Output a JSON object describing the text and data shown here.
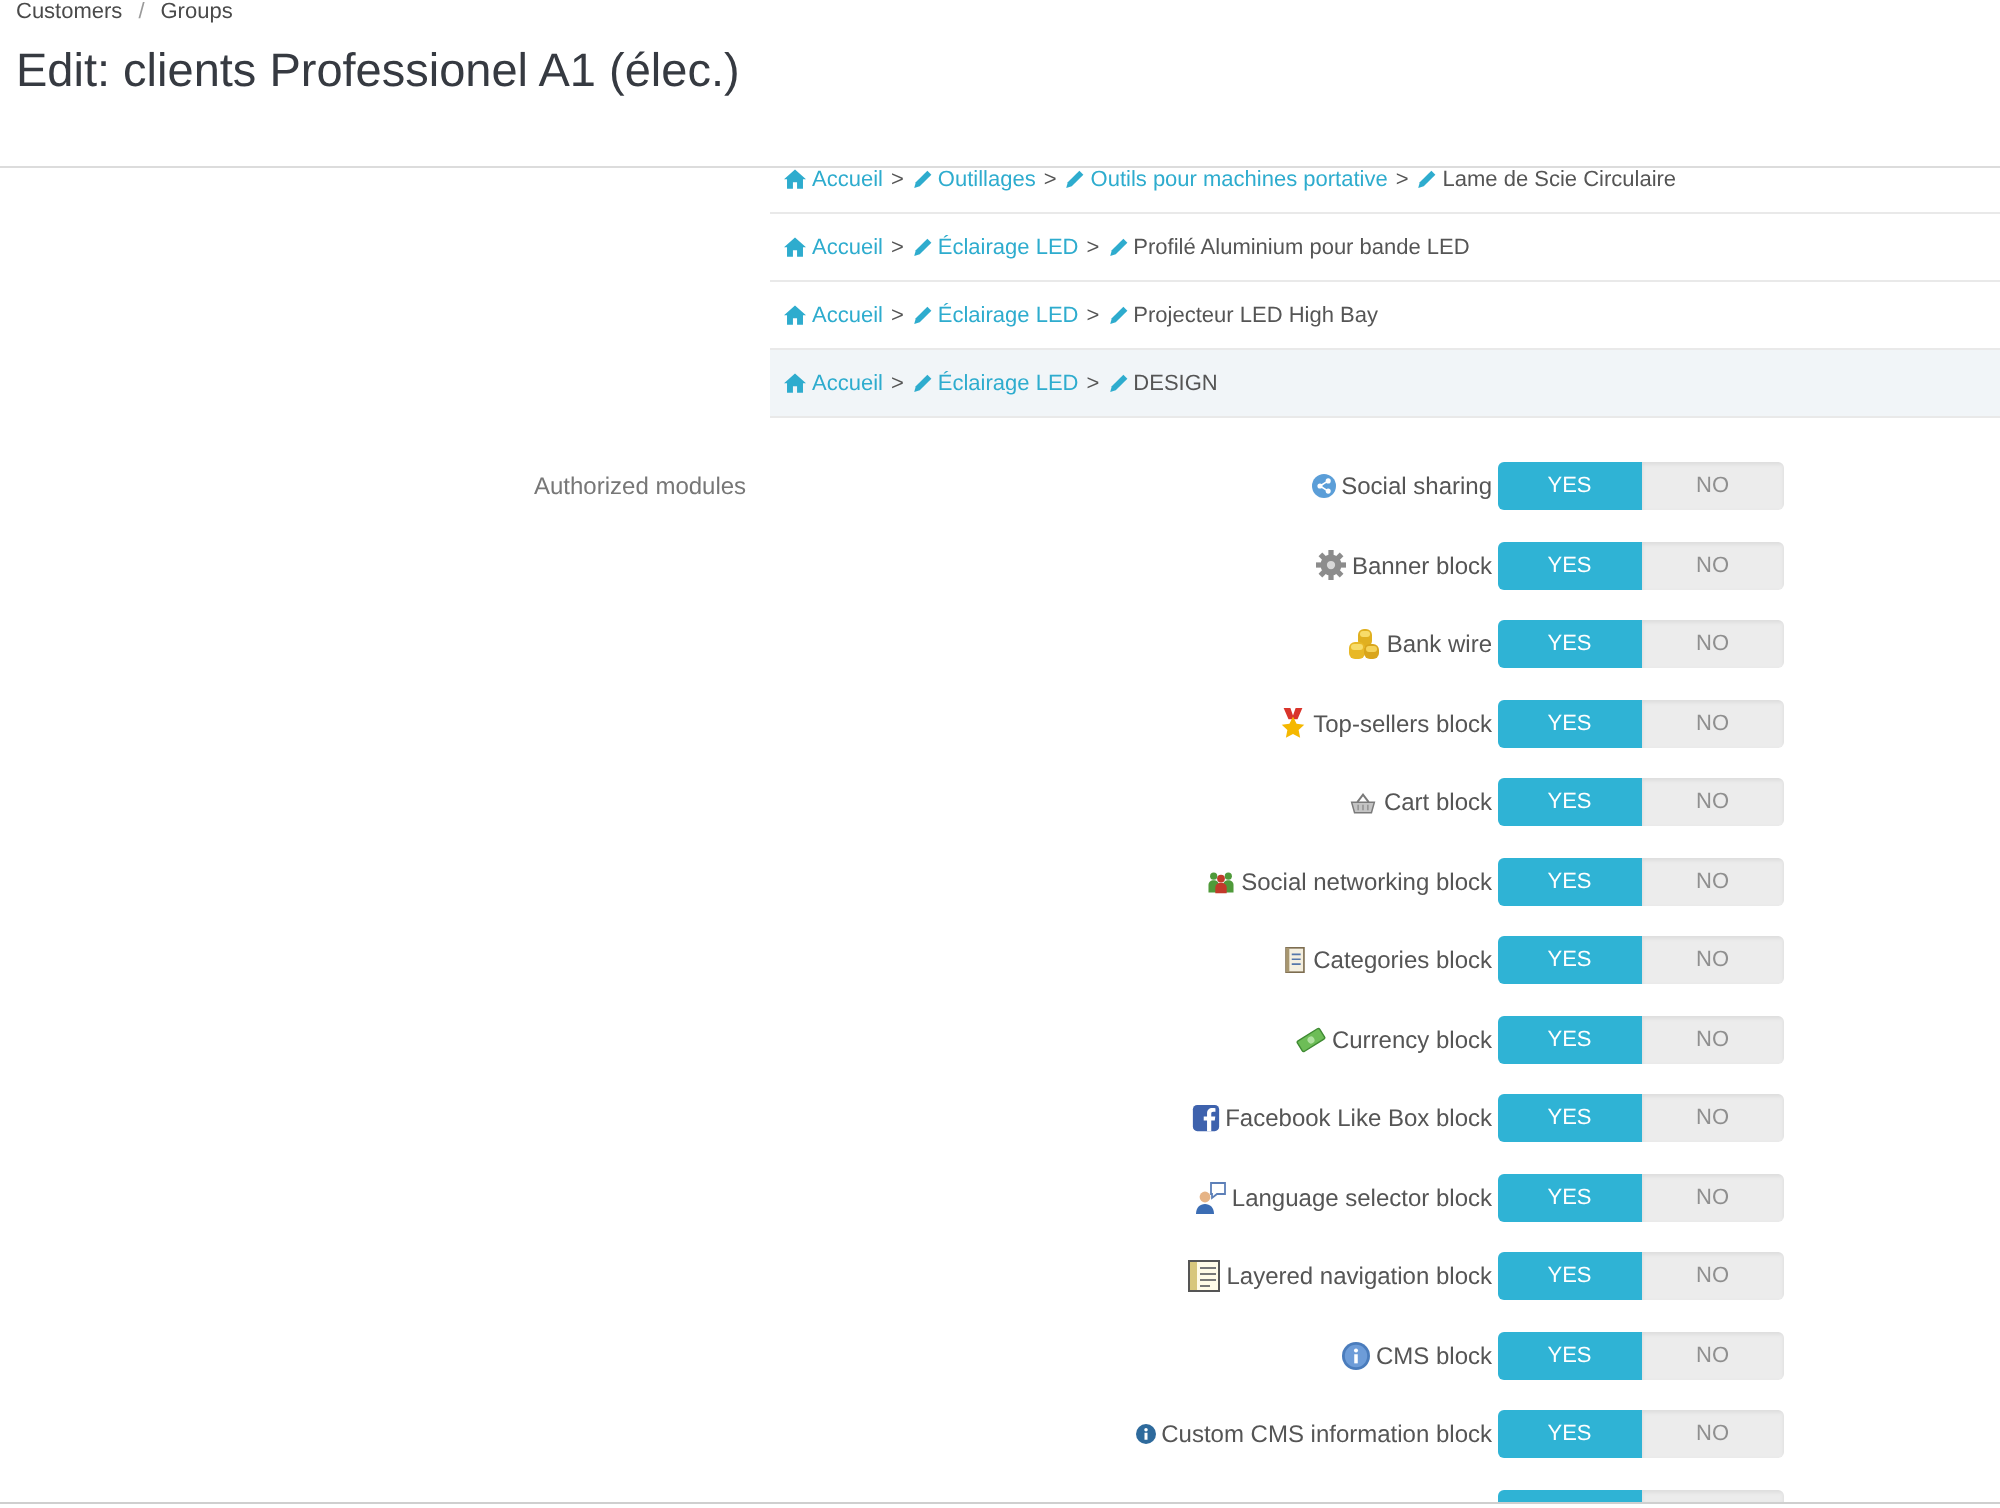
{
  "header": {
    "breadcrumb": [
      {
        "kind": "link",
        "label": "Customers"
      },
      {
        "kind": "separator",
        "label": "/"
      },
      {
        "kind": "link",
        "label": "Groups"
      }
    ],
    "title": "Edit: clients Professionel A1 (élec.)"
  },
  "category_paths": [
    {
      "highlighted": false,
      "items": [
        {
          "kind": "root",
          "label": "Accueil"
        },
        {
          "kind": "separator",
          "label": ">"
        },
        {
          "kind": "category",
          "label": "Outillages"
        },
        {
          "kind": "separator",
          "label": ">"
        },
        {
          "kind": "category",
          "label": "Outils pour machines portative"
        },
        {
          "kind": "separator",
          "label": ">"
        },
        {
          "kind": "current",
          "label": "Lame de Scie Circulaire"
        }
      ]
    },
    {
      "highlighted": false,
      "items": [
        {
          "kind": "root",
          "label": "Accueil"
        },
        {
          "kind": "separator",
          "label": ">"
        },
        {
          "kind": "category",
          "label": "Éclairage LED"
        },
        {
          "kind": "separator",
          "label": ">"
        },
        {
          "kind": "current",
          "label": "Profilé Aluminium pour bande LED"
        }
      ]
    },
    {
      "highlighted": false,
      "items": [
        {
          "kind": "root",
          "label": "Accueil"
        },
        {
          "kind": "separator",
          "label": ">"
        },
        {
          "kind": "category",
          "label": "Éclairage LED"
        },
        {
          "kind": "separator",
          "label": ">"
        },
        {
          "kind": "current",
          "label": "Projecteur LED High Bay"
        }
      ]
    },
    {
      "highlighted": true,
      "items": [
        {
          "kind": "root",
          "label": "Accueil"
        },
        {
          "kind": "separator",
          "label": ">"
        },
        {
          "kind": "category",
          "label": "Éclairage LED"
        },
        {
          "kind": "separator",
          "label": ">"
        },
        {
          "kind": "current",
          "label": "DESIGN"
        }
      ]
    }
  ],
  "modules": {
    "label": "Authorized modules",
    "items": [
      {
        "label": "Social sharing",
        "enabled": true,
        "yes_label": "YES",
        "no_label": "NO"
      },
      {
        "label": "Banner block",
        "enabled": true,
        "yes_label": "YES",
        "no_label": "NO"
      },
      {
        "label": "Bank wire",
        "enabled": true,
        "yes_label": "YES",
        "no_label": "NO"
      },
      {
        "label": "Top-sellers block",
        "enabled": true,
        "yes_label": "YES",
        "no_label": "NO"
      },
      {
        "label": "Cart block",
        "enabled": true,
        "yes_label": "YES",
        "no_label": "NO"
      },
      {
        "label": "Social networking block",
        "enabled": true,
        "yes_label": "YES",
        "no_label": "NO"
      },
      {
        "label": "Categories block",
        "enabled": true,
        "yes_label": "YES",
        "no_label": "NO"
      },
      {
        "label": "Currency block",
        "enabled": true,
        "yes_label": "YES",
        "no_label": "NO"
      },
      {
        "label": "Facebook Like Box block",
        "enabled": true,
        "yes_label": "YES",
        "no_label": "NO"
      },
      {
        "label": "Language selector block",
        "enabled": true,
        "yes_label": "YES",
        "no_label": "NO"
      },
      {
        "label": "Layered navigation block",
        "enabled": true,
        "yes_label": "YES",
        "no_label": "NO"
      },
      {
        "label": "CMS block",
        "enabled": true,
        "yes_label": "YES",
        "no_label": "NO"
      },
      {
        "label": "Custom CMS information block",
        "enabled": true,
        "yes_label": "YES",
        "no_label": "NO"
      }
    ],
    "cut_off_switch": {
      "enabled": true
    }
  }
}
